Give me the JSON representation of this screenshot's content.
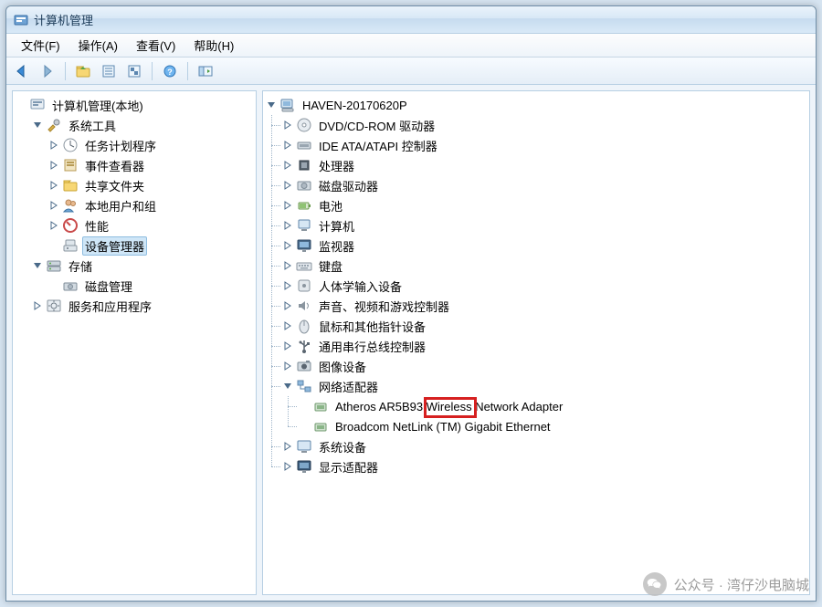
{
  "window": {
    "title": "计算机管理"
  },
  "menu": {
    "file": "文件(F)",
    "action": "操作(A)",
    "view": "查看(V)",
    "help": "帮助(H)"
  },
  "toolbar_icons": {
    "back": "nav-back",
    "forward": "nav-forward",
    "up_folder": "folder-up",
    "properties": "properties",
    "refresh": "refresh",
    "help": "help",
    "show_hide": "show-hide"
  },
  "left_tree": {
    "root": {
      "label": "计算机管理(本地)",
      "icon": "console-icon"
    },
    "system_tools": {
      "label": "系统工具",
      "icon": "tools-icon",
      "children": {
        "task_scheduler": {
          "label": "任务计划程序",
          "icon": "clock-icon"
        },
        "event_viewer": {
          "label": "事件查看器",
          "icon": "event-viewer-icon"
        },
        "shared_folders": {
          "label": "共享文件夹",
          "icon": "shared-folder-icon"
        },
        "local_users": {
          "label": "本地用户和组",
          "icon": "users-icon"
        },
        "performance": {
          "label": "性能",
          "icon": "performance-icon"
        },
        "device_manager": {
          "label": "设备管理器",
          "icon": "device-manager-icon"
        }
      }
    },
    "storage": {
      "label": "存储",
      "icon": "storage-icon",
      "children": {
        "disk_management": {
          "label": "磁盘管理",
          "icon": "disk-icon"
        }
      }
    },
    "services_apps": {
      "label": "服务和应用程序",
      "icon": "services-icon"
    }
  },
  "right_tree": {
    "computer": {
      "label": "HAVEN-20170620P",
      "icon": "computer-icon"
    },
    "categories": {
      "dvd": {
        "label": "DVD/CD-ROM 驱动器",
        "icon": "dvd-icon"
      },
      "ide": {
        "label": "IDE ATA/ATAPI 控制器",
        "icon": "ide-icon"
      },
      "cpu": {
        "label": "处理器",
        "icon": "cpu-icon"
      },
      "diskdrives": {
        "label": "磁盘驱动器",
        "icon": "diskdrive-icon"
      },
      "battery": {
        "label": "电池",
        "icon": "battery-icon"
      },
      "computer_c": {
        "label": "计算机",
        "icon": "computer-small-icon"
      },
      "monitor": {
        "label": "监视器",
        "icon": "monitor-icon"
      },
      "keyboard": {
        "label": "键盘",
        "icon": "keyboard-icon"
      },
      "hid": {
        "label": "人体学输入设备",
        "icon": "hid-icon"
      },
      "sound": {
        "label": "声音、视频和游戏控制器",
        "icon": "sound-icon"
      },
      "mouse": {
        "label": "鼠标和其他指针设备",
        "icon": "mouse-icon"
      },
      "usb": {
        "label": "通用串行总线控制器",
        "icon": "usb-icon"
      },
      "imaging": {
        "label": "图像设备",
        "icon": "imaging-icon"
      },
      "network": {
        "label": "网络适配器",
        "icon": "network-icon",
        "children": {
          "wifi": {
            "label": "Atheros AR5B93 Wireless Network Adapter",
            "icon": "nic-icon"
          },
          "lan": {
            "label": "Broadcom NetLink (TM) Gigabit Ethernet",
            "icon": "nic-icon"
          }
        }
      },
      "system": {
        "label": "系统设备",
        "icon": "system-device-icon"
      },
      "display": {
        "label": "显示适配器",
        "icon": "display-icon"
      }
    }
  },
  "highlight": {
    "target": "Wireless"
  },
  "watermark": {
    "text": "公众号 · 湾仔沙电脑城"
  }
}
